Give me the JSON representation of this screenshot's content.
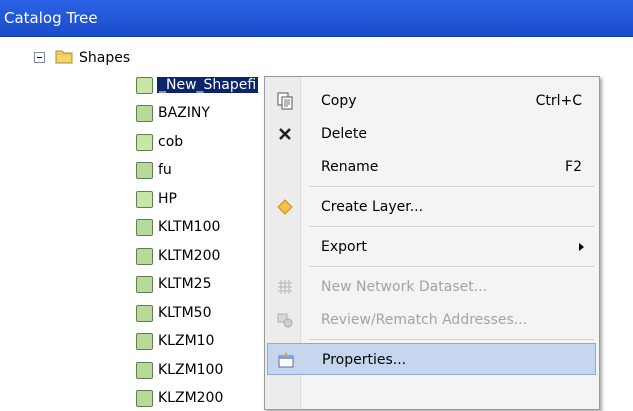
{
  "panel": {
    "title": "Catalog Tree"
  },
  "tree": {
    "folder": {
      "label": "Shapes",
      "icon": "folder-icon"
    },
    "items": [
      {
        "label": "_New_Shapefi",
        "type": "point",
        "selected": true
      },
      {
        "label": "BAZINY",
        "type": "polygon"
      },
      {
        "label": "cob",
        "type": "point"
      },
      {
        "label": "fu",
        "type": "polygon"
      },
      {
        "label": "HP",
        "type": "point"
      },
      {
        "label": "KLTM100",
        "type": "polygon"
      },
      {
        "label": "KLTM200",
        "type": "polygon"
      },
      {
        "label": "KLTM25",
        "type": "polygon"
      },
      {
        "label": "KLTM50",
        "type": "polygon"
      },
      {
        "label": "KLZM10",
        "type": "polygon"
      },
      {
        "label": "KLZM100",
        "type": "polygon"
      },
      {
        "label": "KLZM200",
        "type": "polygon"
      }
    ]
  },
  "context_menu": {
    "items": [
      {
        "label": "Copy",
        "shortcut": "Ctrl+C",
        "icon": "copy-icon",
        "enabled": true
      },
      {
        "label": "Delete",
        "shortcut": "",
        "icon": "delete-icon",
        "enabled": true
      },
      {
        "label": "Rename",
        "shortcut": "F2",
        "icon": "",
        "enabled": true
      },
      {
        "label": "Create Layer...",
        "shortcut": "",
        "icon": "create-layer-icon",
        "enabled": true
      },
      {
        "label": "Export",
        "shortcut": "",
        "icon": "",
        "enabled": true,
        "submenu": true
      },
      {
        "label": "New Network Dataset...",
        "shortcut": "",
        "icon": "network-dataset-icon",
        "enabled": false
      },
      {
        "label": "Review/Rematch Addresses...",
        "shortcut": "",
        "icon": "rematch-icon",
        "enabled": false
      },
      {
        "label": "Properties...",
        "shortcut": "",
        "icon": "properties-icon",
        "enabled": true,
        "highlighted": true
      }
    ]
  },
  "colors": {
    "title_bar": "#1f55d6",
    "selection": "#0b246a",
    "menu_highlight": "#c6d6ef"
  }
}
